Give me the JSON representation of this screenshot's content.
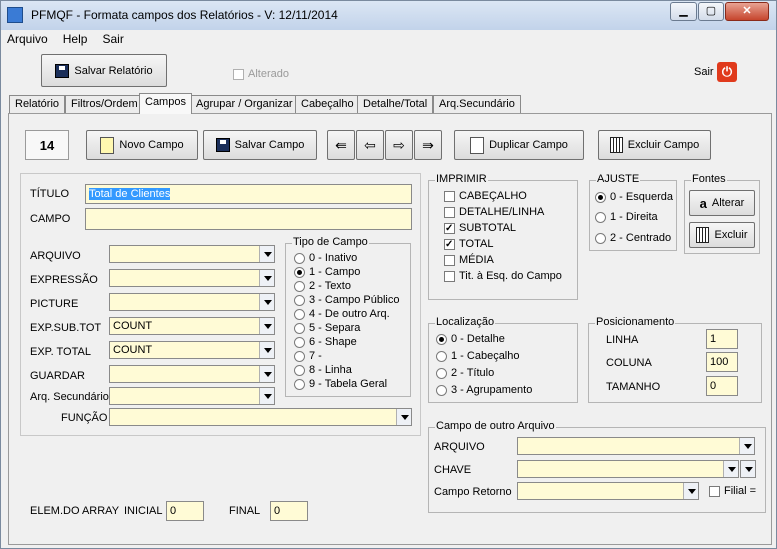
{
  "window": {
    "title": "PFMQF - Formata campos dos Relatórios - V: 12/11/2014"
  },
  "menu": [
    "Arquivo",
    "Help",
    "Sair"
  ],
  "toolbar": {
    "save_report": "Salvar Relatório",
    "alterado": "Alterado",
    "exit": "Sair"
  },
  "tabs": [
    "Relatório",
    "Filtros/Ordem",
    "Campos",
    "Agrupar / Organizar",
    "Cabeçalho",
    "Detalhe/Total",
    "Arq.Secundário"
  ],
  "record": {
    "counter": "14",
    "new_field": "Novo Campo",
    "save_field": "Salvar Campo",
    "duplicate_field": "Duplicar Campo",
    "delete_field": "Excluir Campo"
  },
  "form": {
    "titulo_label": "TÍTULO",
    "titulo_value": "Total de Clientes",
    "campo_label": "CAMPO",
    "campo_value": "",
    "arquivo_label": "ARQUIVO",
    "arquivo_value": "",
    "expressao_label": "EXPRESSÃO",
    "expressao_value": "",
    "picture_label": "PICTURE",
    "picture_value": "",
    "expsubtot_label": "EXP.SUB.TOT",
    "expsubtot_value": "COUNT",
    "exptotal_label": "EXP. TOTAL",
    "exptotal_value": "COUNT",
    "guardar_label": "GUARDAR",
    "guardar_value": "",
    "arqsec_label": "Arq. Secundário",
    "arqsec_value": "",
    "funcao_label": "FUNÇÃO",
    "funcao_value": ""
  },
  "tipo_campo": {
    "title": "Tipo de Campo",
    "options": [
      "0 - Inativo",
      "1 - Campo",
      "2 - Texto",
      "3 - Campo Público",
      "4 - De outro Arq.",
      "5 - Separa",
      "6 - Shape",
      "7 -",
      "8 - Linha",
      "9 - Tabela Geral"
    ],
    "selected": "1 - Campo"
  },
  "imprimir": {
    "title": "IMPRIMIR",
    "options": [
      "CABEÇALHO",
      "DETALHE/LINHA",
      "SUBTOTAL",
      "TOTAL",
      "MÉDIA",
      "Tit. à Esq. do Campo"
    ],
    "checked": [
      "SUBTOTAL",
      "TOTAL"
    ]
  },
  "ajuste": {
    "title": "AJUSTE",
    "options": [
      "0 - Esquerda",
      "1 - Direita",
      "2 - Centrado"
    ],
    "selected": "0 - Esquerda"
  },
  "fontes": {
    "title": "Fontes",
    "alterar": "Alterar",
    "excluir": "Excluir"
  },
  "localizacao": {
    "title": "Localização",
    "options": [
      "0 - Detalhe",
      "1 - Cabeçalho",
      "2 - Título",
      "3 - Agrupamento"
    ],
    "selected": "0 - Detalhe"
  },
  "posicionamento": {
    "title": "Posicionamento",
    "linha_label": "LINHA",
    "linha_value": "1",
    "coluna_label": "COLUNA",
    "coluna_value": "100",
    "tamanho_label": "TAMANHO",
    "tamanho_value": "0"
  },
  "outro_arquivo": {
    "title": "Campo de outro Arquivo",
    "arquivo_label": "ARQUIVO",
    "chave_label": "CHAVE",
    "retorno_label": "Campo Retorno",
    "filial_label": "Filial ="
  },
  "array": {
    "label": "ELEM.DO ARRAY",
    "inicial_label": "INICIAL",
    "inicial_value": "0",
    "final_label": "FINAL",
    "final_value": "0"
  }
}
